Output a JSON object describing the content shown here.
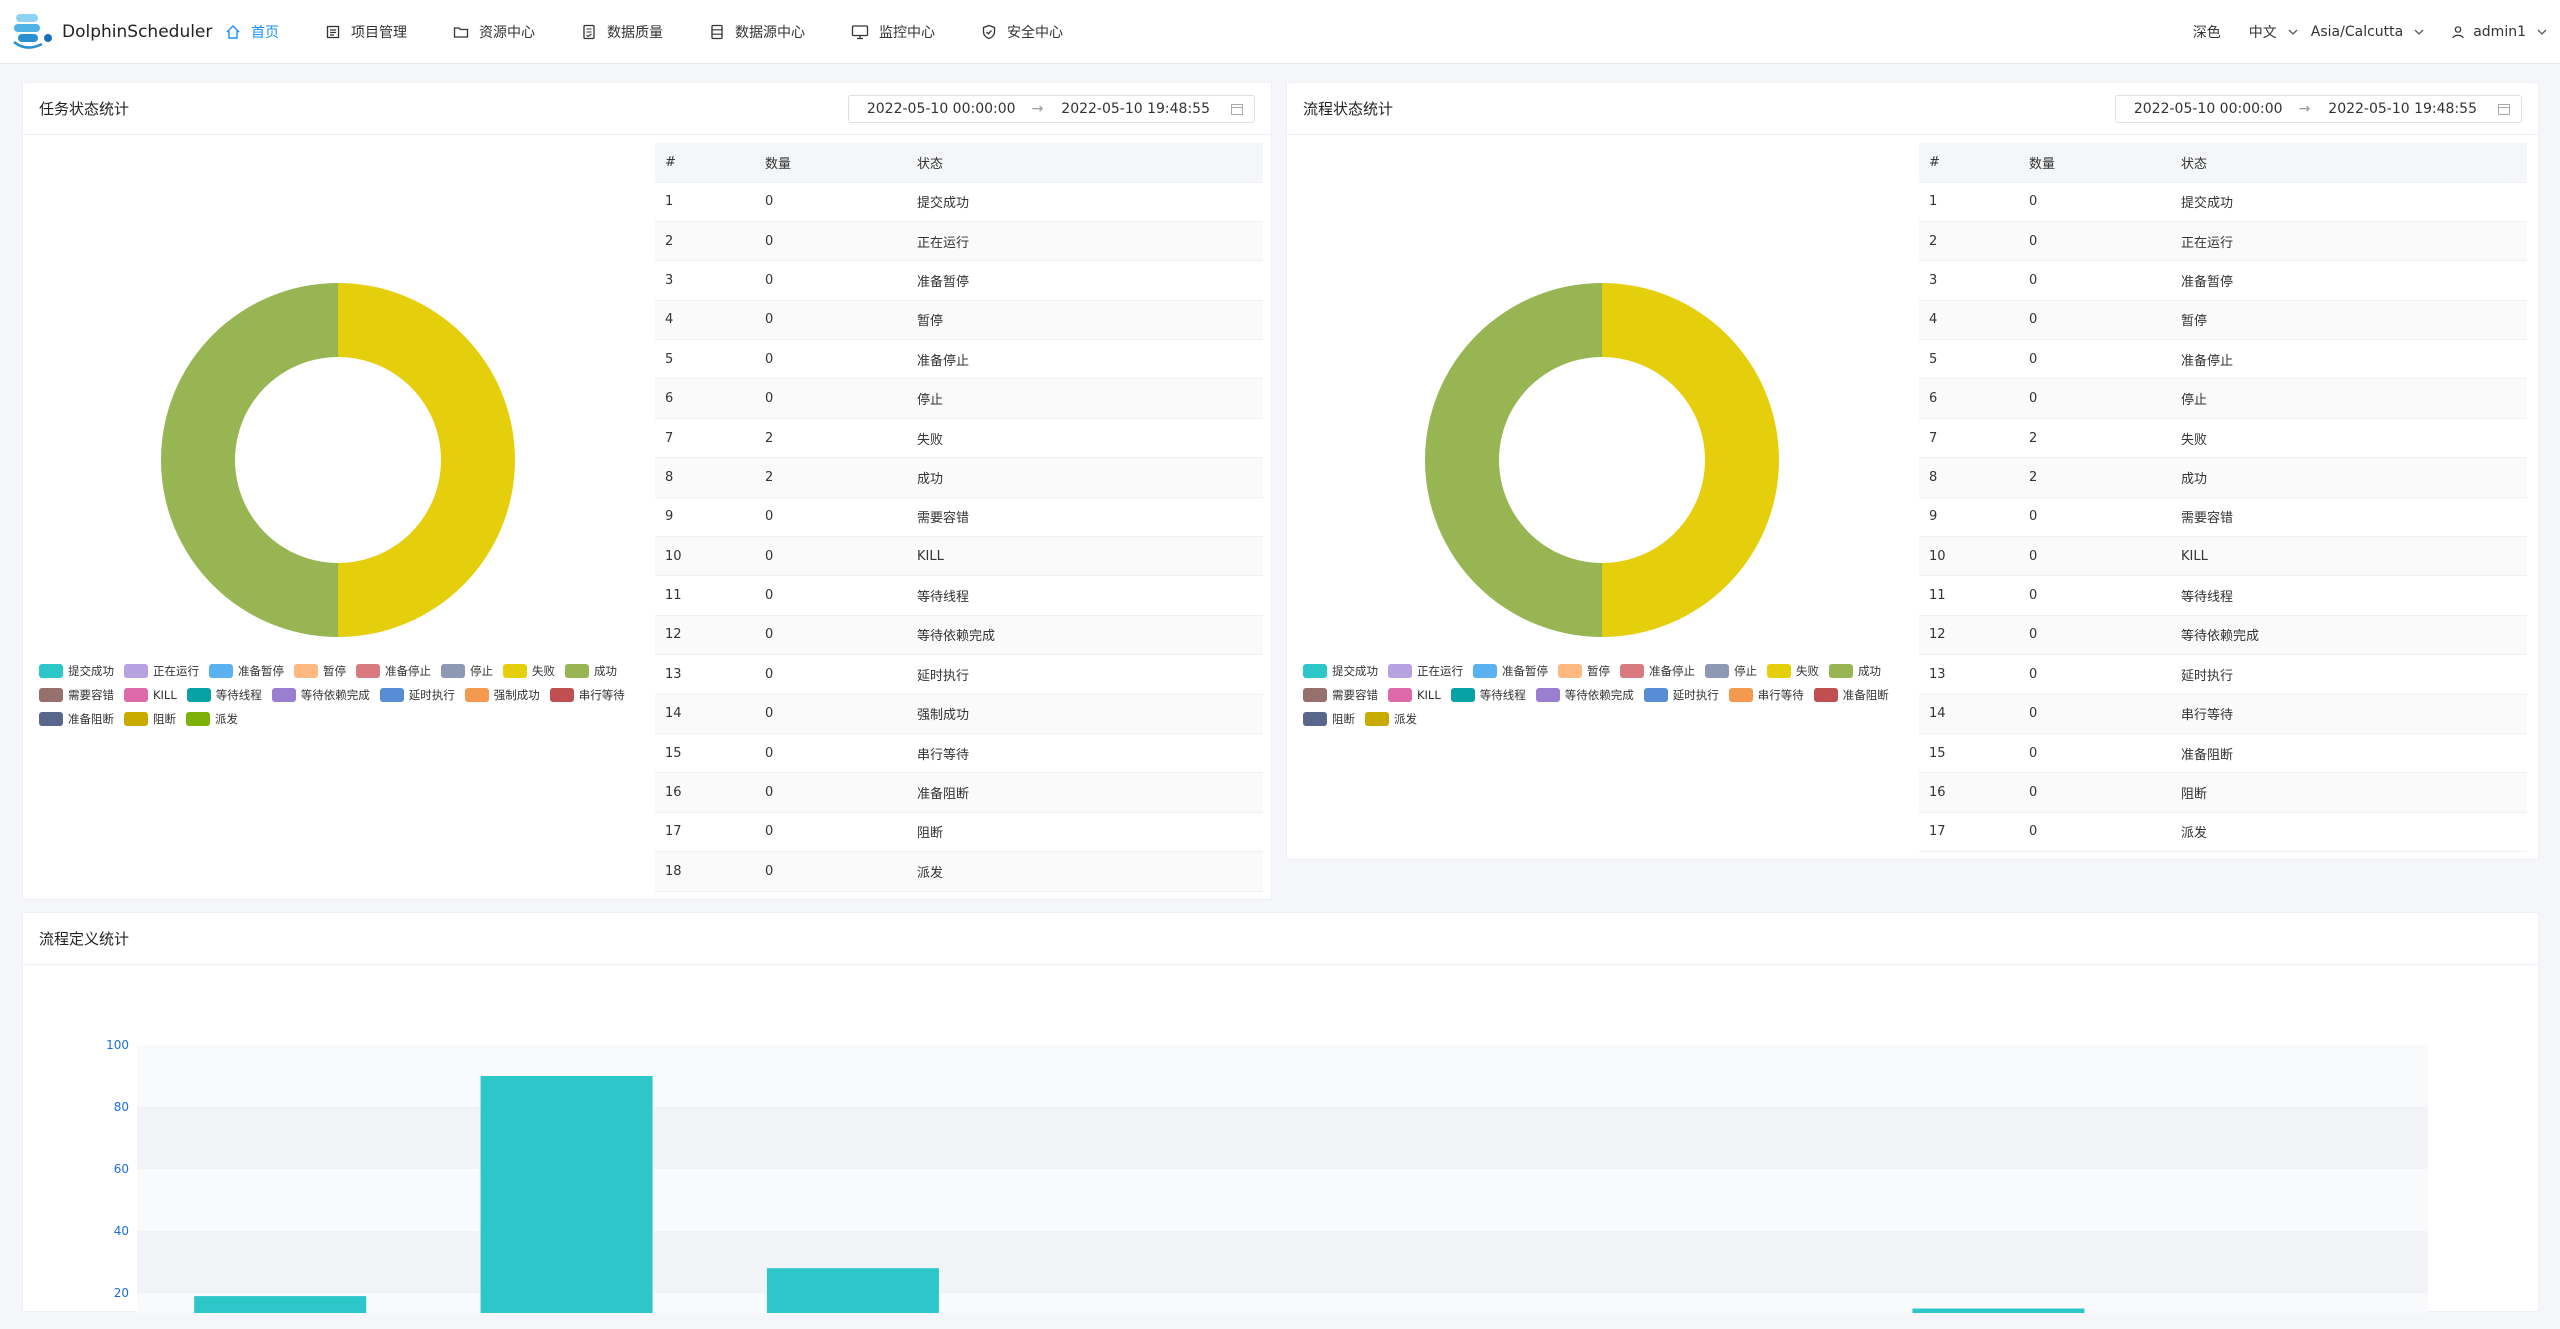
{
  "app": {
    "name": "DolphinScheduler",
    "nav": [
      "首页",
      "项目管理",
      "资源中心",
      "数据质量",
      "数据源中心",
      "监控中心",
      "安全中心"
    ],
    "theme": "深色",
    "language": "中文",
    "timezone": "Asia/Calcutta",
    "user": "admin1",
    "accent": "#1890ff"
  },
  "task_panel": {
    "title": "任务状态统计",
    "date_start": "2022-05-10 00:00:00",
    "date_end": "2022-05-10 19:48:55",
    "table_headers": [
      "#",
      "数量",
      "状态"
    ],
    "rows": [
      [
        "1",
        "0",
        "提交成功"
      ],
      [
        "2",
        "0",
        "正在运行"
      ],
      [
        "3",
        "0",
        "准备暂停"
      ],
      [
        "4",
        "0",
        "暂停"
      ],
      [
        "5",
        "0",
        "准备停止"
      ],
      [
        "6",
        "0",
        "停止"
      ],
      [
        "7",
        "2",
        "失败"
      ],
      [
        "8",
        "2",
        "成功"
      ],
      [
        "9",
        "0",
        "需要容错"
      ],
      [
        "10",
        "0",
        "KILL"
      ],
      [
        "11",
        "0",
        "等待线程"
      ],
      [
        "12",
        "0",
        "等待依赖完成"
      ],
      [
        "13",
        "0",
        "延时执行"
      ],
      [
        "14",
        "0",
        "强制成功"
      ],
      [
        "15",
        "0",
        "串行等待"
      ],
      [
        "16",
        "0",
        "准备阻断"
      ],
      [
        "17",
        "0",
        "阻断"
      ],
      [
        "18",
        "0",
        "派发"
      ]
    ],
    "legend": [
      {
        "label": "提交成功",
        "color": "#2ec7c9"
      },
      {
        "label": "正在运行",
        "color": "#b6a2de"
      },
      {
        "label": "准备暂停",
        "color": "#5ab1ef"
      },
      {
        "label": "暂停",
        "color": "#ffb980"
      },
      {
        "label": "准备停止",
        "color": "#d87a80"
      },
      {
        "label": "停止",
        "color": "#8d98b3"
      },
      {
        "label": "失败",
        "color": "#e5cf0d"
      },
      {
        "label": "成功",
        "color": "#97b552"
      },
      {
        "label": "需要容错",
        "color": "#95706d"
      },
      {
        "label": "KILL",
        "color": "#dc69aa"
      },
      {
        "label": "等待线程",
        "color": "#07a2a4"
      },
      {
        "label": "等待依赖完成",
        "color": "#9a7fd1"
      },
      {
        "label": "延时执行",
        "color": "#588dd5"
      },
      {
        "label": "强制成功",
        "color": "#f5994e"
      },
      {
        "label": "串行等待",
        "color": "#c05050"
      },
      {
        "label": "准备阻断",
        "color": "#59678c"
      },
      {
        "label": "阻断",
        "color": "#c9ab00"
      },
      {
        "label": "派发",
        "color": "#7eb00a"
      }
    ]
  },
  "process_panel": {
    "title": "流程状态统计",
    "date_start": "2022-05-10 00:00:00",
    "date_end": "2022-05-10 19:48:55",
    "table_headers": [
      "#",
      "数量",
      "状态"
    ],
    "rows": [
      [
        "1",
        "0",
        "提交成功"
      ],
      [
        "2",
        "0",
        "正在运行"
      ],
      [
        "3",
        "0",
        "准备暂停"
      ],
      [
        "4",
        "0",
        "暂停"
      ],
      [
        "5",
        "0",
        "准备停止"
      ],
      [
        "6",
        "0",
        "停止"
      ],
      [
        "7",
        "2",
        "失败"
      ],
      [
        "8",
        "2",
        "成功"
      ],
      [
        "9",
        "0",
        "需要容错"
      ],
      [
        "10",
        "0",
        "KILL"
      ],
      [
        "11",
        "0",
        "等待线程"
      ],
      [
        "12",
        "0",
        "等待依赖完成"
      ],
      [
        "13",
        "0",
        "延时执行"
      ],
      [
        "14",
        "0",
        "串行等待"
      ],
      [
        "15",
        "0",
        "准备阻断"
      ],
      [
        "16",
        "0",
        "阻断"
      ],
      [
        "17",
        "0",
        "派发"
      ]
    ],
    "legend": [
      {
        "label": "提交成功",
        "color": "#2ec7c9"
      },
      {
        "label": "正在运行",
        "color": "#b6a2de"
      },
      {
        "label": "准备暂停",
        "color": "#5ab1ef"
      },
      {
        "label": "暂停",
        "color": "#ffb980"
      },
      {
        "label": "准备停止",
        "color": "#d87a80"
      },
      {
        "label": "停止",
        "color": "#8d98b3"
      },
      {
        "label": "失败",
        "color": "#e5cf0d"
      },
      {
        "label": "成功",
        "color": "#97b552"
      },
      {
        "label": "需要容错",
        "color": "#95706d"
      },
      {
        "label": "KILL",
        "color": "#dc69aa"
      },
      {
        "label": "等待线程",
        "color": "#07a2a4"
      },
      {
        "label": "等待依赖完成",
        "color": "#9a7fd1"
      },
      {
        "label": "延时执行",
        "color": "#588dd5"
      },
      {
        "label": "串行等待",
        "color": "#f5994e"
      },
      {
        "label": "准备阻断",
        "color": "#c05050"
      },
      {
        "label": "阻断",
        "color": "#59678c"
      },
      {
        "label": "派发",
        "color": "#c9ab00"
      }
    ]
  },
  "definition_panel": {
    "title": "流程定义统计"
  },
  "chart_data": [
    {
      "type": "pie",
      "categories": [
        "失败",
        "成功"
      ],
      "values": [
        2,
        2
      ],
      "colors": [
        "#e5cf0d",
        "#97b552"
      ]
    },
    {
      "type": "pie",
      "categories": [
        "失败",
        "成功"
      ],
      "values": [
        2,
        2
      ],
      "colors": [
        "#e5cf0d",
        "#97b552"
      ]
    },
    {
      "type": "bar",
      "bar_color": "#2ec7c9",
      "values": [
        19,
        90,
        28,
        0,
        0,
        0,
        15,
        0
      ],
      "yticks": [
        "100",
        "80",
        "60",
        "40",
        "20"
      ],
      "ylim": [
        0,
        100
      ],
      "grid": true
    }
  ]
}
